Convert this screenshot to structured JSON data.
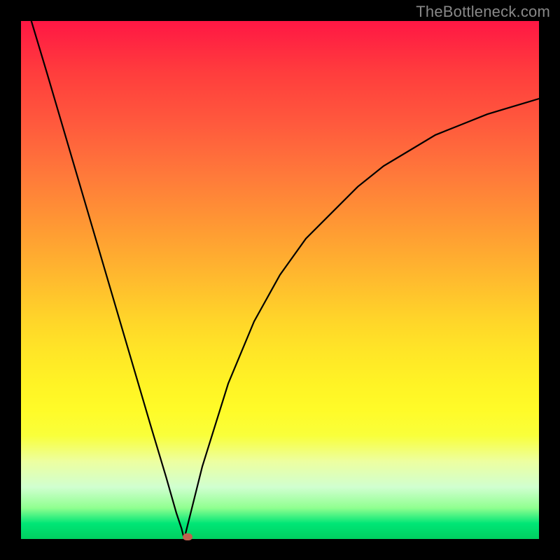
{
  "watermark": "TheBottleneck.com",
  "chart_data": {
    "type": "line",
    "title": "",
    "xlabel": "",
    "ylabel": "",
    "xlim": [
      0,
      1
    ],
    "ylim": [
      0,
      1
    ],
    "series": [
      {
        "name": "bottleneck-curve",
        "x": [
          0.02,
          0.05,
          0.1,
          0.15,
          0.2,
          0.25,
          0.28,
          0.3,
          0.31,
          0.315,
          0.32,
          0.33,
          0.35,
          0.4,
          0.45,
          0.5,
          0.55,
          0.6,
          0.65,
          0.7,
          0.75,
          0.8,
          0.85,
          0.9,
          0.95,
          1.0
        ],
        "y": [
          1.0,
          0.9,
          0.73,
          0.56,
          0.39,
          0.22,
          0.12,
          0.05,
          0.02,
          0.0,
          0.02,
          0.06,
          0.14,
          0.3,
          0.42,
          0.51,
          0.58,
          0.63,
          0.68,
          0.72,
          0.75,
          0.78,
          0.8,
          0.82,
          0.835,
          0.85
        ]
      }
    ],
    "marker": {
      "x": 0.322,
      "y": 0.0,
      "color": "#c1614f"
    },
    "gradient_stops": [
      {
        "pos": 0.0,
        "color": "#ff1744"
      },
      {
        "pos": 0.5,
        "color": "#ffd629"
      },
      {
        "pos": 0.75,
        "color": "#fffb28"
      },
      {
        "pos": 0.97,
        "color": "#00e676"
      },
      {
        "pos": 1.0,
        "color": "#00d060"
      }
    ]
  }
}
